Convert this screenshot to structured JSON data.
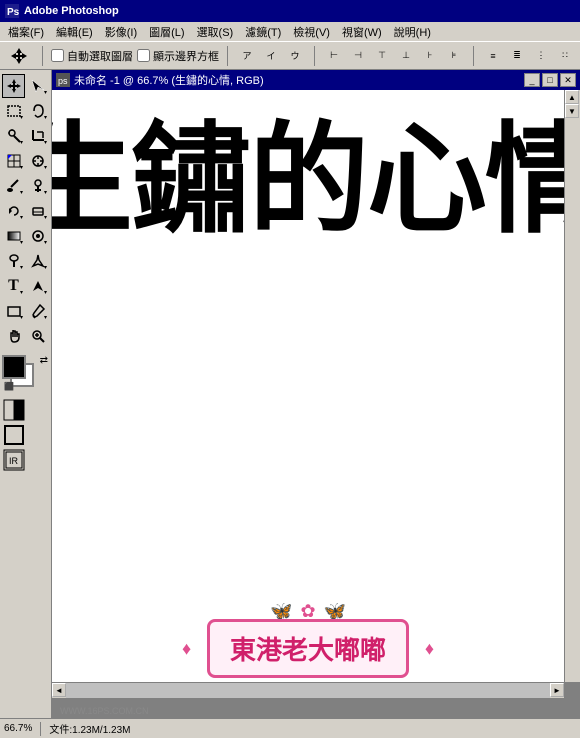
{
  "app": {
    "title": "Adobe Photoshop"
  },
  "menu": {
    "items": [
      "檔案(F)",
      "編輯(E)",
      "影像(I)",
      "圖層(L)",
      "選取(S)",
      "濾鏡(T)",
      "檢視(V)",
      "視窗(W)",
      "說明(H)"
    ]
  },
  "options_bar": {
    "auto_select_label": "自動選取圖層",
    "show_bounds_label": "顯示邊界方框"
  },
  "document": {
    "title": "未命名 -1 @ 66.7% (生鏽的心情, RGB)"
  },
  "canvas": {
    "main_text": "生鏽的心情",
    "badge_text": "東港老大嘟嘟"
  },
  "status_bar": {
    "zoom": "66.7%",
    "doc_info": "文件:1.23M/1.23M"
  },
  "watermark": {
    "text": "WWW.16PS.COM.CN"
  },
  "icons": {
    "move": "✛",
    "marquee": "⬚",
    "lasso": "⌇",
    "magic_wand": "✦",
    "crop": "⊡",
    "slice": "⌗",
    "heal": "⊕",
    "brush": "✏",
    "clone": "⊗",
    "history": "◎",
    "eraser": "◫",
    "gradient": "▦",
    "blur": "◉",
    "dodge": "○",
    "pen": "✒",
    "text": "T",
    "path": "⊳",
    "shape": "▭",
    "eyedropper": "✎",
    "note": "✉",
    "hand": "✋",
    "zoom": "🔍"
  }
}
